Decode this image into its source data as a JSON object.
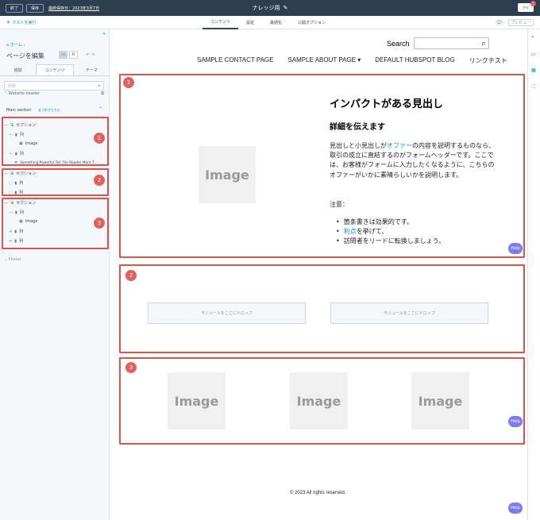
{
  "topbar": {
    "exit_label": "終了",
    "save_label": "保存",
    "last_saved": "最終保存日：2023年3月7日",
    "page_title": "ナレッジ用",
    "update_label": "更新",
    "notification_count": "1"
  },
  "tabbar": {
    "run_test": "テストを実行",
    "tabs": [
      {
        "label": "コンテンツ",
        "active": true
      },
      {
        "label": "設定"
      },
      {
        "label": "最適化"
      },
      {
        "label": "公開オプション"
      }
    ],
    "preview_label": "プレビュー"
  },
  "sidebar": {
    "breadcrumb": "ホーム",
    "title": "ページを編集",
    "count": "0",
    "tabs": [
      "追加",
      "コンテンツ",
      "テーマ"
    ],
    "search_placeholder": "検索",
    "website_header": "Website header",
    "main_section": "Main section",
    "fold_all": "全て折りたたむ",
    "footer_label": "Footer",
    "tree": [
      {
        "label": "セクション",
        "kind": "section"
      },
      {
        "label": "列",
        "kind": "column"
      },
      {
        "label": "Image",
        "kind": "module"
      },
      {
        "label": "列",
        "kind": "column"
      },
      {
        "label": "Something Powerful Tell The Reader More T...",
        "kind": "module"
      },
      {
        "label": "セクション",
        "kind": "section"
      },
      {
        "label": "列",
        "kind": "column"
      },
      {
        "label": "列",
        "kind": "column"
      },
      {
        "label": "セクション",
        "kind": "section"
      },
      {
        "label": "列",
        "kind": "column"
      },
      {
        "label": "Image",
        "kind": "module"
      },
      {
        "label": "列",
        "kind": "column"
      },
      {
        "label": "列",
        "kind": "column"
      }
    ]
  },
  "annotations": [
    "1",
    "2",
    "3"
  ],
  "site": {
    "search_label": "Search",
    "nav": [
      "SAMPLE CONTACT PAGE",
      "SAMPLE ABOUT PAGE ▾",
      "DEFAULT HUBSPOT BLOG",
      "リンクテスト"
    ],
    "image_label": "Image",
    "headline": "インパクトがある見出し",
    "subheadline": "詳細を伝えます",
    "body_prefix": "見出しと小見出しが",
    "body_link": "オファー",
    "body_suffix": "の内容を説明するものなら、取引の成立に直結するのがフォームヘッダーです。ここでは、お客様がフォームに入力したくなるように、こちらのオファーがいかに素晴らしいかを説明します。",
    "note_label": "注意：",
    "bullet_1": "箇条書きは効果的です。",
    "bullet_2_link": "利点",
    "bullet_2_suffix": "を挙げて、",
    "bullet_3": "訪問者をリードに転換しましょう。",
    "dropzone_label": "モジュールをここにドロップ",
    "help_label": "Help",
    "copyright": "© 2023 All rights reserved."
  },
  "colors": {
    "topbar_bg": "#2d3e50",
    "annotation_red": "#d9534f",
    "link_blue": "#0091d6",
    "help_purple": "#7c7cf0"
  }
}
